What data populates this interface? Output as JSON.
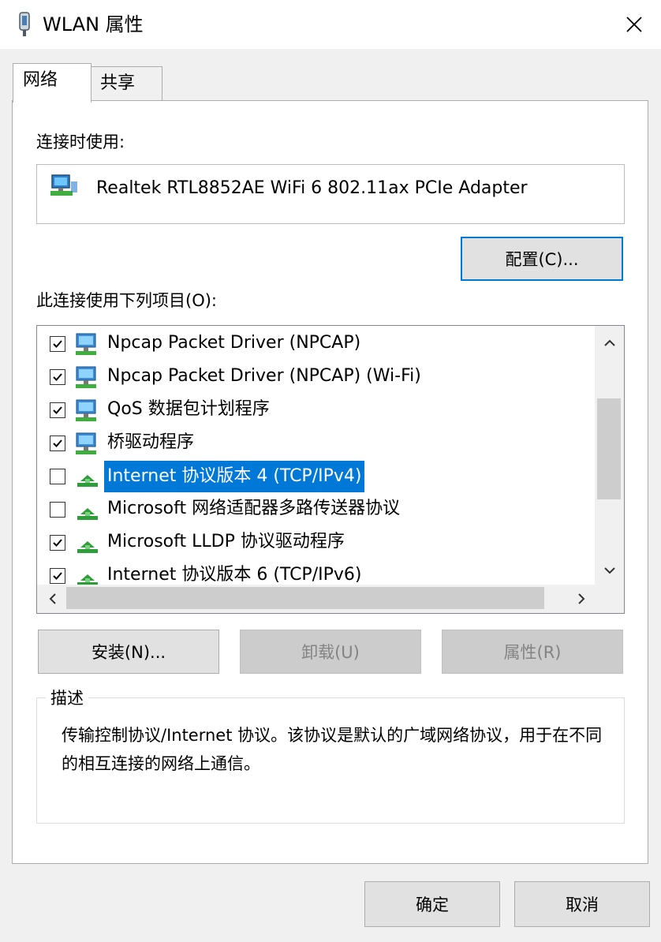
{
  "window": {
    "title": "WLAN 属性",
    "close_label": "×"
  },
  "tabs": [
    {
      "label": "网络",
      "active": true
    },
    {
      "label": "共享",
      "active": false
    }
  ],
  "connect_using": {
    "label": "连接时使用:",
    "adapter_name": "Realtek RTL8852AE WiFi 6 802.11ax PCIe Adapter",
    "configure_button": "配置(C)..."
  },
  "items": {
    "label": "此连接使用下列项目(O):",
    "list": [
      {
        "label": "Npcap Packet Driver (NPCAP)",
        "checked": true,
        "icon": "network-service-icon",
        "selected": false
      },
      {
        "label": "Npcap Packet Driver (NPCAP) (Wi-Fi)",
        "checked": true,
        "icon": "network-service-icon",
        "selected": false
      },
      {
        "label": "QoS 数据包计划程序",
        "checked": true,
        "icon": "network-service-icon",
        "selected": false
      },
      {
        "label": "桥驱动程序",
        "checked": true,
        "icon": "network-service-icon",
        "selected": false
      },
      {
        "label": "Internet 协议版本 4 (TCP/IPv4)",
        "checked": false,
        "icon": "protocol-icon",
        "selected": true
      },
      {
        "label": "Microsoft 网络适配器多路传送器协议",
        "checked": false,
        "icon": "protocol-icon",
        "selected": false
      },
      {
        "label": "Microsoft LLDP 协议驱动程序",
        "checked": true,
        "icon": "protocol-icon",
        "selected": false
      },
      {
        "label": "Internet 协议版本 6 (TCP/IPv6)",
        "checked": true,
        "icon": "protocol-icon",
        "selected": false
      }
    ]
  },
  "buttons": {
    "install": "安装(N)...",
    "uninstall": "卸载(U)",
    "properties": "属性(R)",
    "ok": "确定",
    "cancel": "取消"
  },
  "description": {
    "legend": "描述",
    "text": "传输控制协议/Internet 协议。该协议是默认的广域网络协议，用于在不同的相互连接的网络上通信。"
  },
  "colors": {
    "selection": "#0078d7",
    "focus_border": "#0078d7"
  }
}
